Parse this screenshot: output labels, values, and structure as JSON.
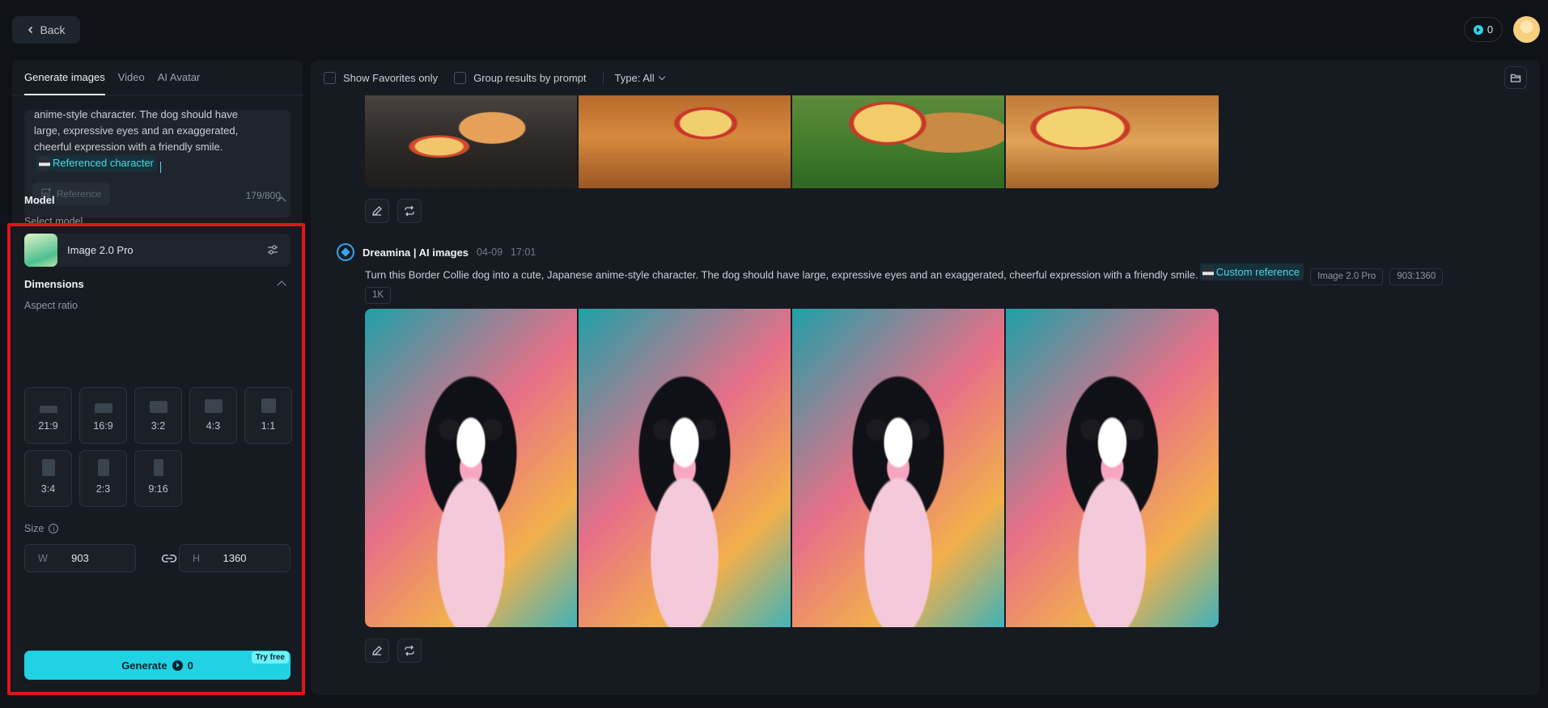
{
  "header": {
    "back_label": "Back",
    "credits": "0"
  },
  "sidebar": {
    "tabs": [
      {
        "label": "Generate images"
      },
      {
        "label": "Video"
      },
      {
        "label": "AI Avatar"
      }
    ],
    "prompt": {
      "text": "anime-style character. The dog should have large, expressive eyes and an exaggerated, cheerful expression with a friendly smile.",
      "reference_tag": "Referenced character",
      "reference_button": "Reference",
      "char_count": "179/800"
    },
    "model": {
      "title": "Model",
      "select_label": "Select model",
      "name": "Image 2.0 Pro"
    },
    "dimensions": {
      "title": "Dimensions",
      "aspect_label": "Aspect ratio",
      "ratios": [
        "21:9",
        "16:9",
        "3:2",
        "4:3",
        "1:1",
        "3:4",
        "2:3",
        "9:16"
      ],
      "size_label": "Size",
      "width_prefix": "W",
      "width": "903",
      "height_prefix": "H",
      "height": "1360"
    },
    "generate": {
      "label": "Generate",
      "cost": "0",
      "badge": "Try free"
    }
  },
  "main": {
    "filters": {
      "favorites": "Show Favorites only",
      "group": "Group results by prompt",
      "type": "Type: All"
    },
    "generation": {
      "author": "Dreamina | AI images",
      "date": "04-09",
      "time": "17:01",
      "prompt": "Turn this Border Collie dog into a cute, Japanese anime-style character. The dog should have large, expressive eyes and an exaggerated, cheerful expression with a friendly smile.",
      "custom_reference": "Custom reference",
      "tags": [
        "Image 2.0 Pro",
        "903:1360",
        "1K"
      ]
    }
  },
  "colors": {
    "accent": "#20d2e4",
    "highlight": "#e3121b",
    "background": "#0f1216"
  }
}
